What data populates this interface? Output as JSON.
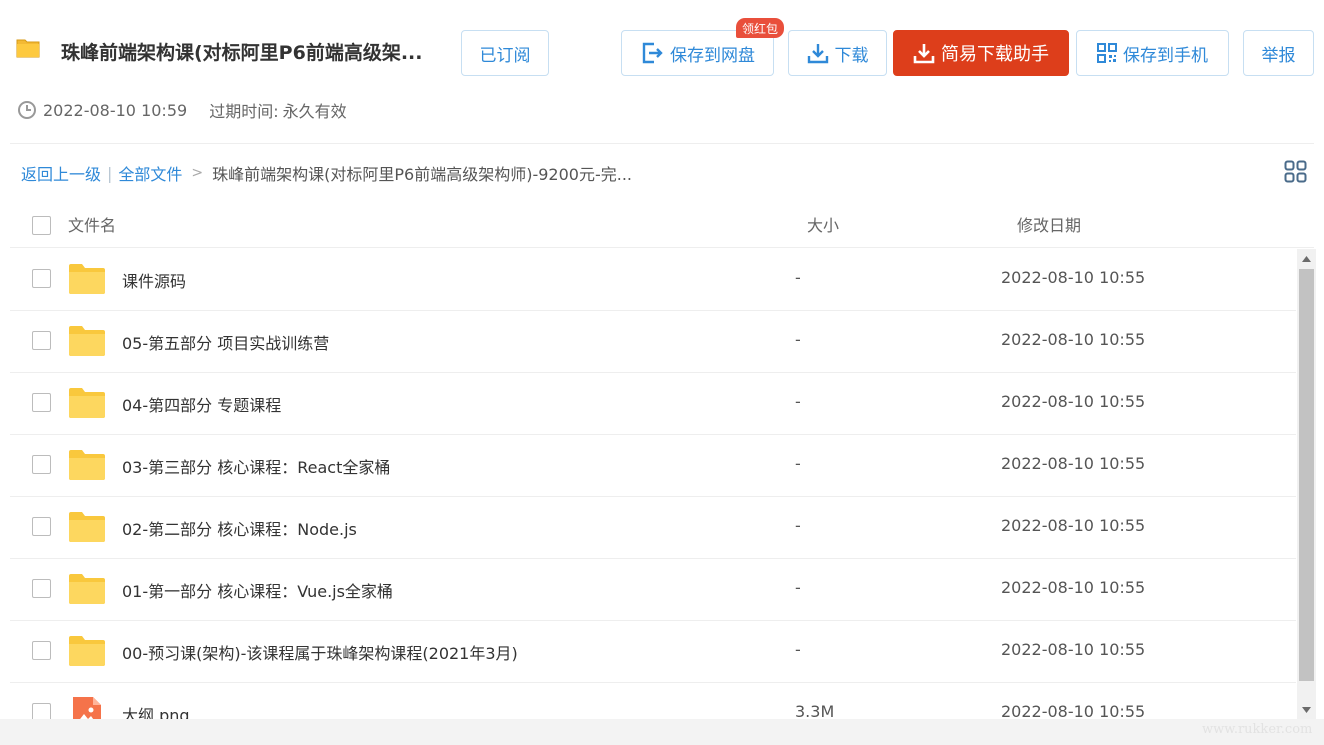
{
  "share": {
    "title": "珠峰前端架构课(对标阿里P6前端高级架...",
    "date": "2022-08-10 10:59",
    "expire_label": "过期时间:",
    "expire_value": "永久有效"
  },
  "toolbar": {
    "subscribed_label": "已订阅",
    "save_label": "保存到网盘",
    "badge_label": "领红包",
    "download_label": "下载",
    "helper_label": "简易下载助手",
    "phone_label": "保存到手机",
    "report_label": "举报"
  },
  "breadcrumb": {
    "back_label": "返回上一级",
    "all_files_label": "全部文件",
    "separator": "|",
    "arrow": ">",
    "current": "珠峰前端架构课(对标阿里P6前端高级架构师)-9200元-完..."
  },
  "table": {
    "headers": {
      "name": "文件名",
      "size": "大小",
      "date": "修改日期"
    },
    "rows": [
      {
        "name": "课件源码",
        "size": "-",
        "date": "2022-08-10 10:55",
        "icon": "folder-icon"
      },
      {
        "name": "05-第五部分 项目实战训练营",
        "size": "-",
        "date": "2022-08-10 10:55",
        "icon": "folder-icon"
      },
      {
        "name": "04-第四部分 专题课程",
        "size": "-",
        "date": "2022-08-10 10:55",
        "icon": "folder-icon"
      },
      {
        "name": "03-第三部分 核心课程：React全家桶",
        "size": "-",
        "date": "2022-08-10 10:55",
        "icon": "folder-icon"
      },
      {
        "name": "02-第二部分 核心课程：Node.js",
        "size": "-",
        "date": "2022-08-10 10:55",
        "icon": "folder-icon"
      },
      {
        "name": "01-第一部分 核心课程：Vue.js全家桶",
        "size": "-",
        "date": "2022-08-10 10:55",
        "icon": "folder-icon"
      },
      {
        "name": "00-预习课(架构)-该课程属于珠峰架构课程(2021年3月)",
        "size": "-",
        "date": "2022-08-10 10:55",
        "icon": "folder-icon"
      },
      {
        "name": "大纲.png",
        "size": "3.3M",
        "date": "2022-08-10 10:55",
        "icon": "image-file-icon"
      }
    ]
  },
  "watermark": "www.rukker.com",
  "colors": {
    "accent": "#2f89d8",
    "helper_button": "#dd3e1b",
    "badge": "#e94f3b",
    "folder": "#fdd45e",
    "image_icon": "#f5734a"
  }
}
